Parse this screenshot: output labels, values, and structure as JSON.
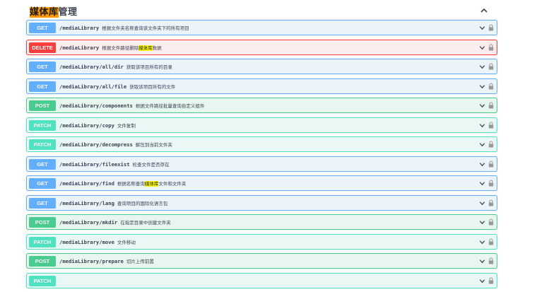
{
  "section": {
    "title_highlight": "媒体库",
    "title_rest": "管理"
  },
  "operations": [
    {
      "method": "GET",
      "path": "/mediaLibrary",
      "desc_before": "根据文件夹名称查询该文件夹下的所有项目",
      "highlight": "",
      "desc_after": ""
    },
    {
      "method": "DELETE",
      "path": "/mediaLibrary",
      "desc_before": "根据文件路径删除",
      "highlight": "媒体库",
      "desc_after": "数据"
    },
    {
      "method": "GET",
      "path": "/mediaLibrary/all/dir",
      "desc_before": "获取该项目所有的目录",
      "highlight": "",
      "desc_after": ""
    },
    {
      "method": "GET",
      "path": "/mediaLibrary/all/file",
      "desc_before": "获取该项目所有的文件",
      "highlight": "",
      "desc_after": ""
    },
    {
      "method": "POST",
      "path": "/mediaLibrary/components",
      "desc_before": "根据文件路径批量查询自定义组件",
      "highlight": "",
      "desc_after": ""
    },
    {
      "method": "PATCH",
      "path": "/mediaLibrary/copy",
      "desc_before": "文件复制",
      "highlight": "",
      "desc_after": ""
    },
    {
      "method": "PATCH",
      "path": "/mediaLibrary/decompress",
      "desc_before": "解压到当前文件夹",
      "highlight": "",
      "desc_after": ""
    },
    {
      "method": "GET",
      "path": "/mediaLibrary/fileexist",
      "desc_before": "检查文件是否存在",
      "highlight": "",
      "desc_after": ""
    },
    {
      "method": "GET",
      "path": "/mediaLibrary/find",
      "desc_before": "根据名称查询",
      "highlight": "媒体库",
      "desc_after": "文件和文件夹"
    },
    {
      "method": "GET",
      "path": "/mediaLibrary/lang",
      "desc_before": "查询项目的国际化语言包",
      "highlight": "",
      "desc_after": ""
    },
    {
      "method": "POST",
      "path": "/mediaLibrary/mkdir",
      "desc_before": "在指定目录中创建文件夹",
      "highlight": "",
      "desc_after": ""
    },
    {
      "method": "PATCH",
      "path": "/mediaLibrary/move",
      "desc_before": "文件移动",
      "highlight": "",
      "desc_after": ""
    },
    {
      "method": "POST",
      "path": "/mediaLibrary/prepare",
      "desc_before": "切片上传前置",
      "highlight": "",
      "desc_after": ""
    },
    {
      "method": "PATCH",
      "path": "",
      "desc_before": "",
      "highlight": "",
      "desc_after": ""
    }
  ],
  "icons": {
    "collapse": "chevron-up-icon",
    "expand": "chevron-down-icon",
    "lock": "lock-icon"
  },
  "colors": {
    "get": "#61affe",
    "delete": "#f93e3e",
    "post": "#49cc90",
    "patch": "#50e3c2",
    "title_highlight": "#ff9900",
    "search_highlight": "#ffff00"
  }
}
